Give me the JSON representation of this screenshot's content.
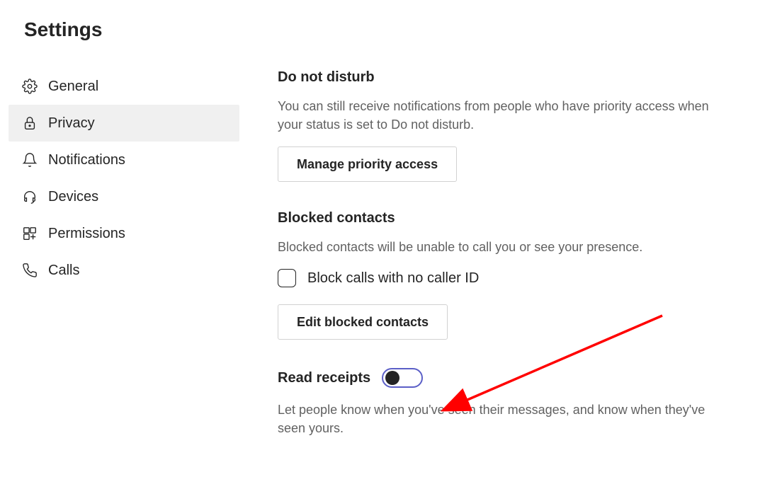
{
  "title": "Settings",
  "sidebar": {
    "items": [
      {
        "label": "General"
      },
      {
        "label": "Privacy"
      },
      {
        "label": "Notifications"
      },
      {
        "label": "Devices"
      },
      {
        "label": "Permissions"
      },
      {
        "label": "Calls"
      }
    ]
  },
  "sections": {
    "dnd": {
      "heading": "Do not disturb",
      "desc": "You can still receive notifications from people who have priority access when your status is set to Do not disturb.",
      "button": "Manage priority access"
    },
    "blocked": {
      "heading": "Blocked contacts",
      "desc": "Blocked contacts will be unable to call you or see your presence.",
      "checkbox_label": "Block calls with no caller ID",
      "button": "Edit blocked contacts"
    },
    "receipts": {
      "heading": "Read receipts",
      "desc": "Let people know when you've seen their messages, and know when they've seen yours."
    }
  }
}
